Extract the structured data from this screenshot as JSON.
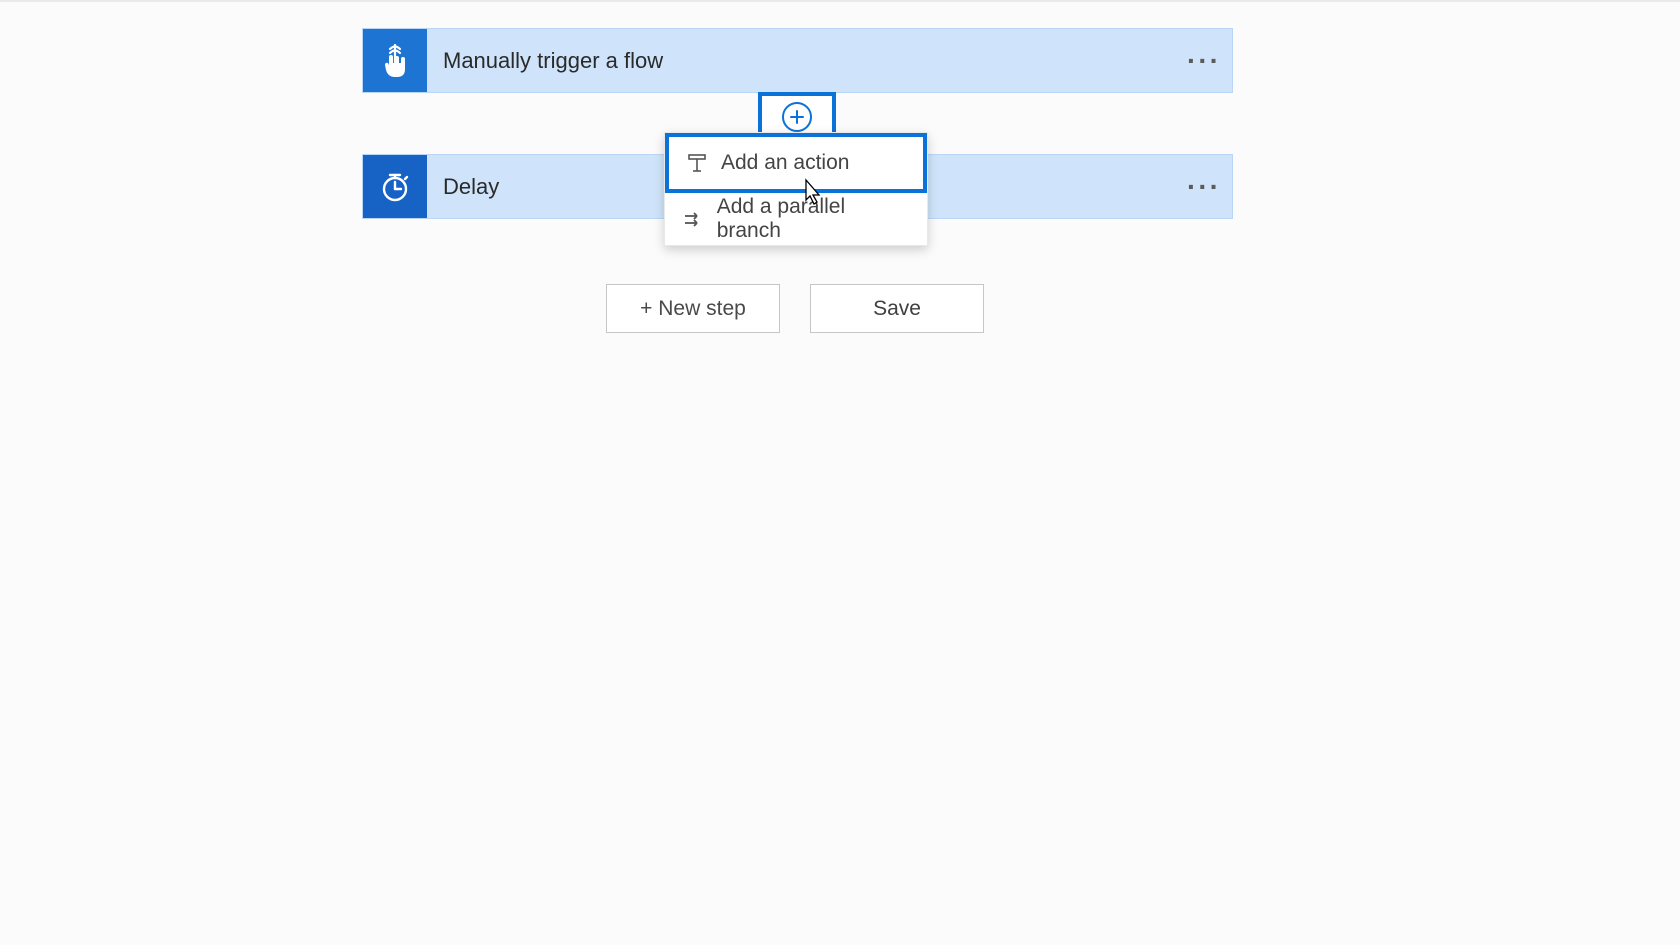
{
  "steps": {
    "trigger": {
      "title": "Manually trigger a flow"
    },
    "delay": {
      "title": "Delay"
    }
  },
  "insertMenu": {
    "addAction": "Add an action",
    "addParallel": "Add a parallel branch"
  },
  "buttons": {
    "newStep": "+ New step",
    "save": "Save"
  }
}
